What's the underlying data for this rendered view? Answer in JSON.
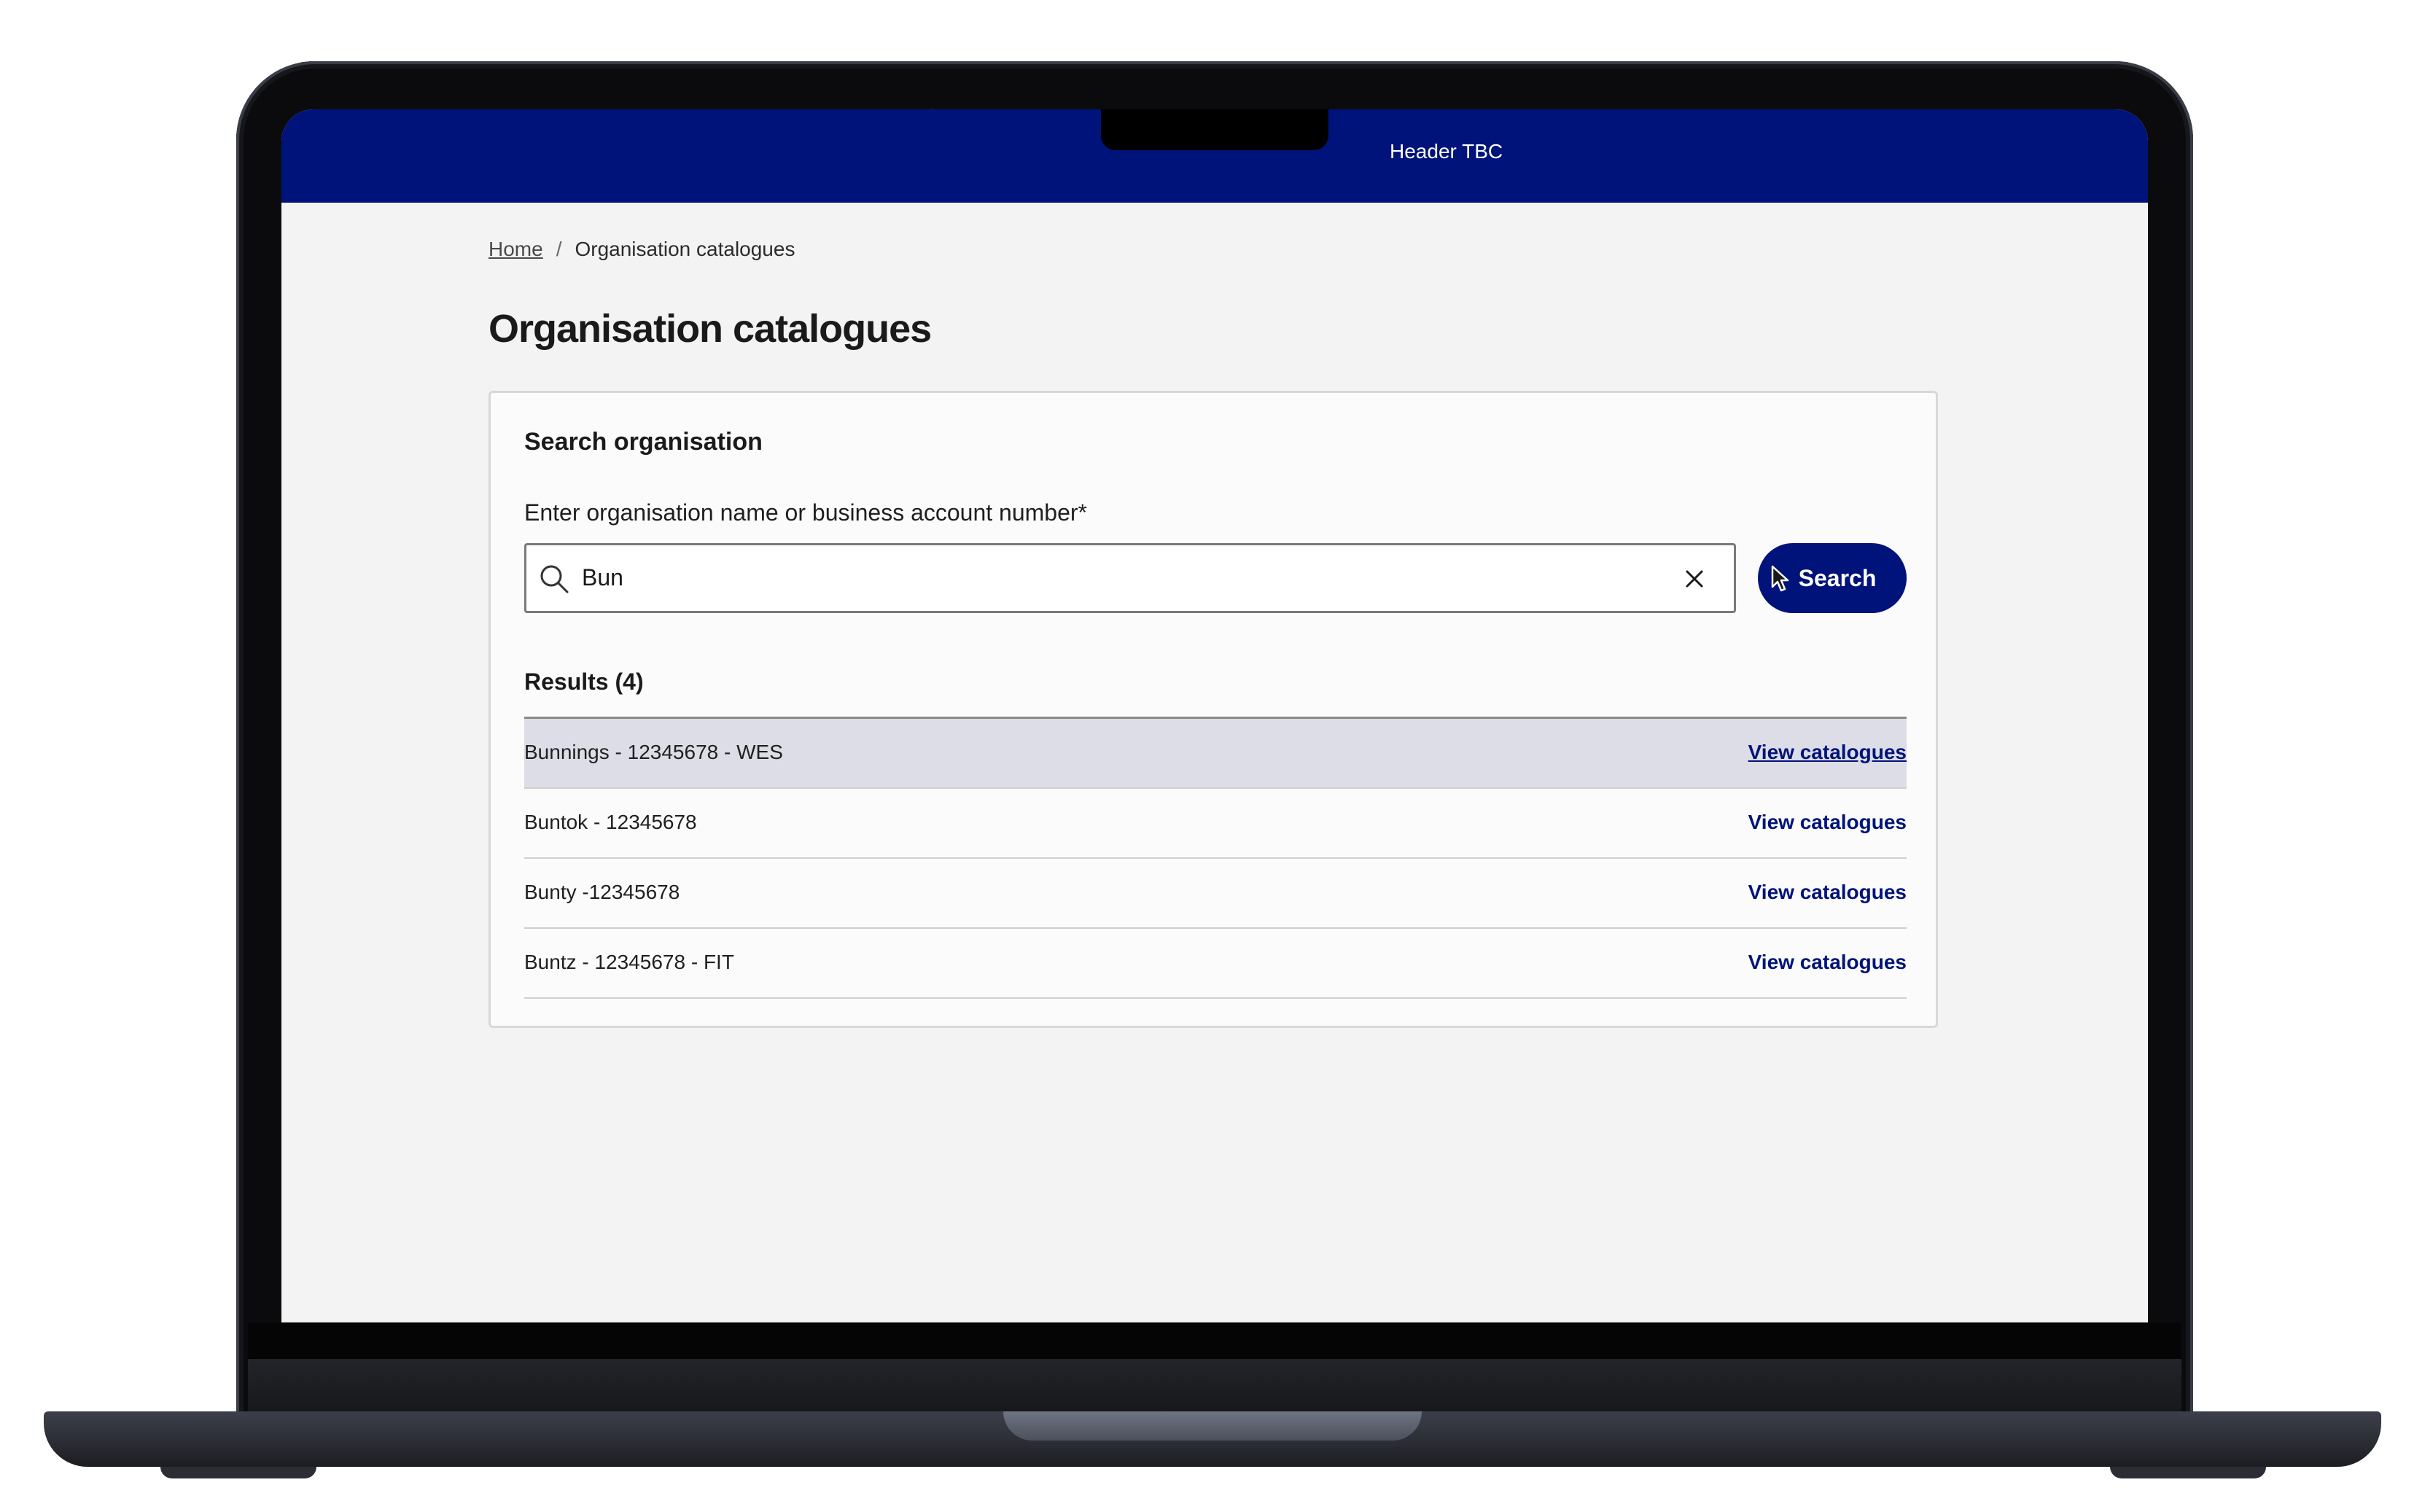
{
  "header": {
    "title": "Header TBC"
  },
  "breadcrumb": {
    "home": "Home",
    "separator": "/",
    "current": "Organisation catalogues"
  },
  "page": {
    "title": "Organisation catalogues"
  },
  "search": {
    "section_title": "Search organisation",
    "label": "Enter organisation name or business account number*",
    "value": "Bun",
    "button_label": "Search"
  },
  "results": {
    "title": "Results (4)",
    "items": [
      {
        "name": "Bunnings - 12345678 - WES",
        "action": "View catalogues",
        "highlighted": true
      },
      {
        "name": "Buntok - 12345678",
        "action": "View catalogues",
        "highlighted": false
      },
      {
        "name": "Bunty -12345678",
        "action": "View catalogues",
        "highlighted": false
      },
      {
        "name": "Buntz - 12345678 - FIT",
        "action": "View catalogues",
        "highlighted": false
      }
    ]
  },
  "colors": {
    "brand": "#00137a",
    "highlight_row": "#dcdde7",
    "page_bg": "#f3f3f3"
  },
  "icons": {
    "search": "search-icon",
    "clear": "close-icon",
    "cursor": "mouse-pointer-icon"
  }
}
